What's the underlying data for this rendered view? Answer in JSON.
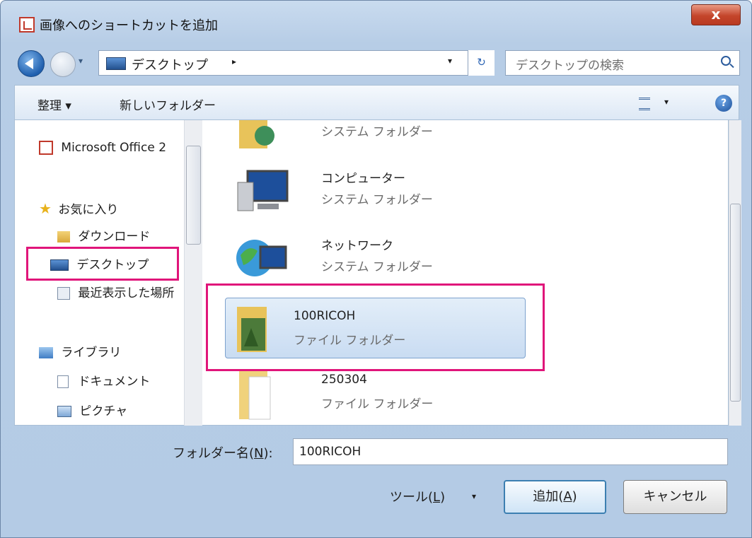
{
  "window": {
    "title": "画像へのショートカットを追加",
    "close_label": "x"
  },
  "address": {
    "path": "デスクトップ",
    "separator": "▸",
    "dropdown": "▾",
    "refresh": "↻",
    "history": "▾"
  },
  "search": {
    "placeholder": "デスクトップの検索"
  },
  "toolbar": {
    "organize": "整理 ▾",
    "new_folder": "新しいフォルダー",
    "view_dropdown": "▾",
    "help": "?"
  },
  "nav": {
    "items": [
      {
        "label": "Microsoft Office 2",
        "icon": "office-icon"
      },
      {
        "label": "お気に入り",
        "icon": "star-icon"
      },
      {
        "label": "ダウンロード",
        "icon": "download-folder-icon"
      },
      {
        "label": "デスクトップ",
        "icon": "desktop-icon"
      },
      {
        "label": "最近表示した場所",
        "icon": "recent-places-icon"
      },
      {
        "label": "ライブラリ",
        "icon": "library-icon"
      },
      {
        "label": "ドキュメント",
        "icon": "document-icon"
      },
      {
        "label": "ピクチャ",
        "icon": "picture-icon"
      }
    ]
  },
  "content": {
    "items": [
      {
        "name": "",
        "type": "システム フォルダー",
        "icon": "user-folder-icon"
      },
      {
        "name": "コンピューター",
        "type": "システム フォルダー",
        "icon": "computer-icon"
      },
      {
        "name": "ネットワーク",
        "type": "システム フォルダー",
        "icon": "network-icon"
      },
      {
        "name": "100RICOH",
        "type": "ファイル フォルダー",
        "icon": "photo-folder-icon",
        "selected": true
      },
      {
        "name": "250304",
        "type": "ファイル フォルダー",
        "icon": "folder-icon"
      }
    ]
  },
  "footer": {
    "folder_name_label_pre": "フォルダー名(",
    "folder_name_label_key": "N",
    "folder_name_label_post": "):",
    "folder_name_value": "100RICOH",
    "tools_pre": "ツール(",
    "tools_key": "L",
    "tools_post": ")",
    "tools_dropdown": "▾",
    "add_pre": "追加(",
    "add_key": "A",
    "add_post": ")",
    "cancel": "キャンセル"
  },
  "colors": {
    "highlight": "#e0157a",
    "selection": "#c9dcf2",
    "frame": "#b7cde6"
  }
}
